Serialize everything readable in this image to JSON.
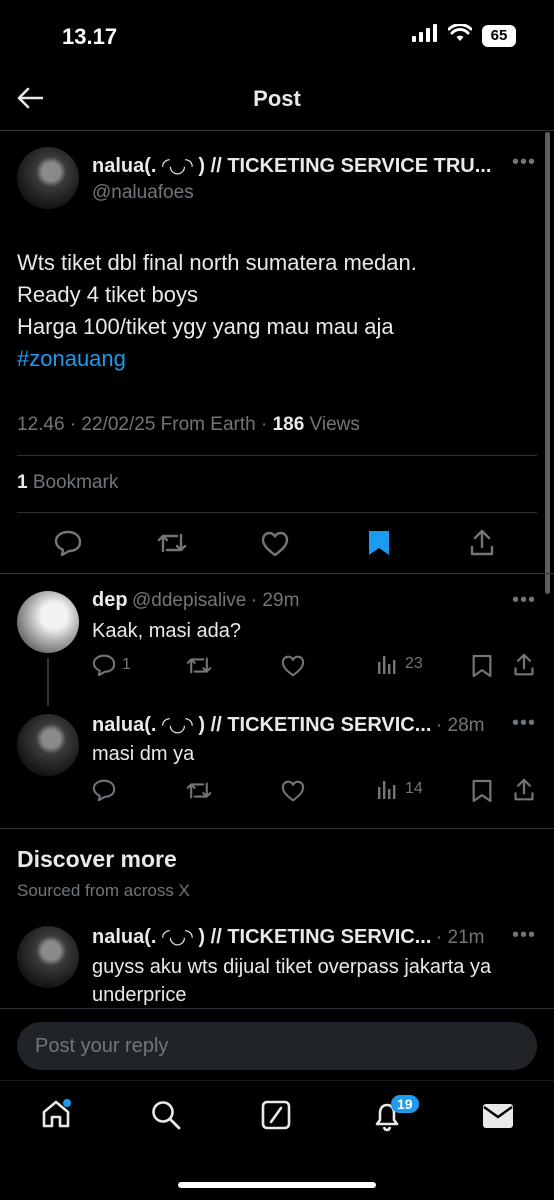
{
  "status_bar": {
    "time": "13.17",
    "battery": "65"
  },
  "header": {
    "title": "Post"
  },
  "main_post": {
    "name": "nalua(. ◜◡◝ ) // TICKETING SERVICE TRU...",
    "handle": "@naluafoes",
    "lines": [
      "Wts tiket dbl final north sumatera medan.",
      "Ready 4 tiket boys",
      "Harga 100/tiket ygy yang mau mau aja"
    ],
    "hashtag": "#zonauang",
    "timestamp": "12.46 · 22/02/25 From Earth · ",
    "views_count": "186",
    "views_label": " Views",
    "bookmarks_count": "1",
    "bookmarks_label": " Bookmark"
  },
  "replies": [
    {
      "name": "dep",
      "handle": "@ddepisalive",
      "time": "· 29m",
      "text": "Kaak, masi ada?",
      "reply_count": "1",
      "views": "23"
    },
    {
      "name": "nalua(. ◜◡◝ ) // TICKETING SERVIC...",
      "handle": "",
      "time": "· 28m",
      "text": "masi dm ya",
      "reply_count": "",
      "views": "14"
    }
  ],
  "discover": {
    "title": "Discover more",
    "subtitle": "Sourced from across X",
    "post": {
      "name": "nalua(. ◜◡◝ ) // TICKETING SERVIC...",
      "time": "· 21m",
      "text": "guyss aku wts dijual tiket overpass jakarta ya underprice"
    }
  },
  "reply_input": {
    "placeholder": "Post your reply"
  },
  "bottom_nav": {
    "notifications_badge": "19"
  },
  "colors": {
    "accent": "#1d9bf0",
    "background": "#000000",
    "muted": "#71767b"
  }
}
